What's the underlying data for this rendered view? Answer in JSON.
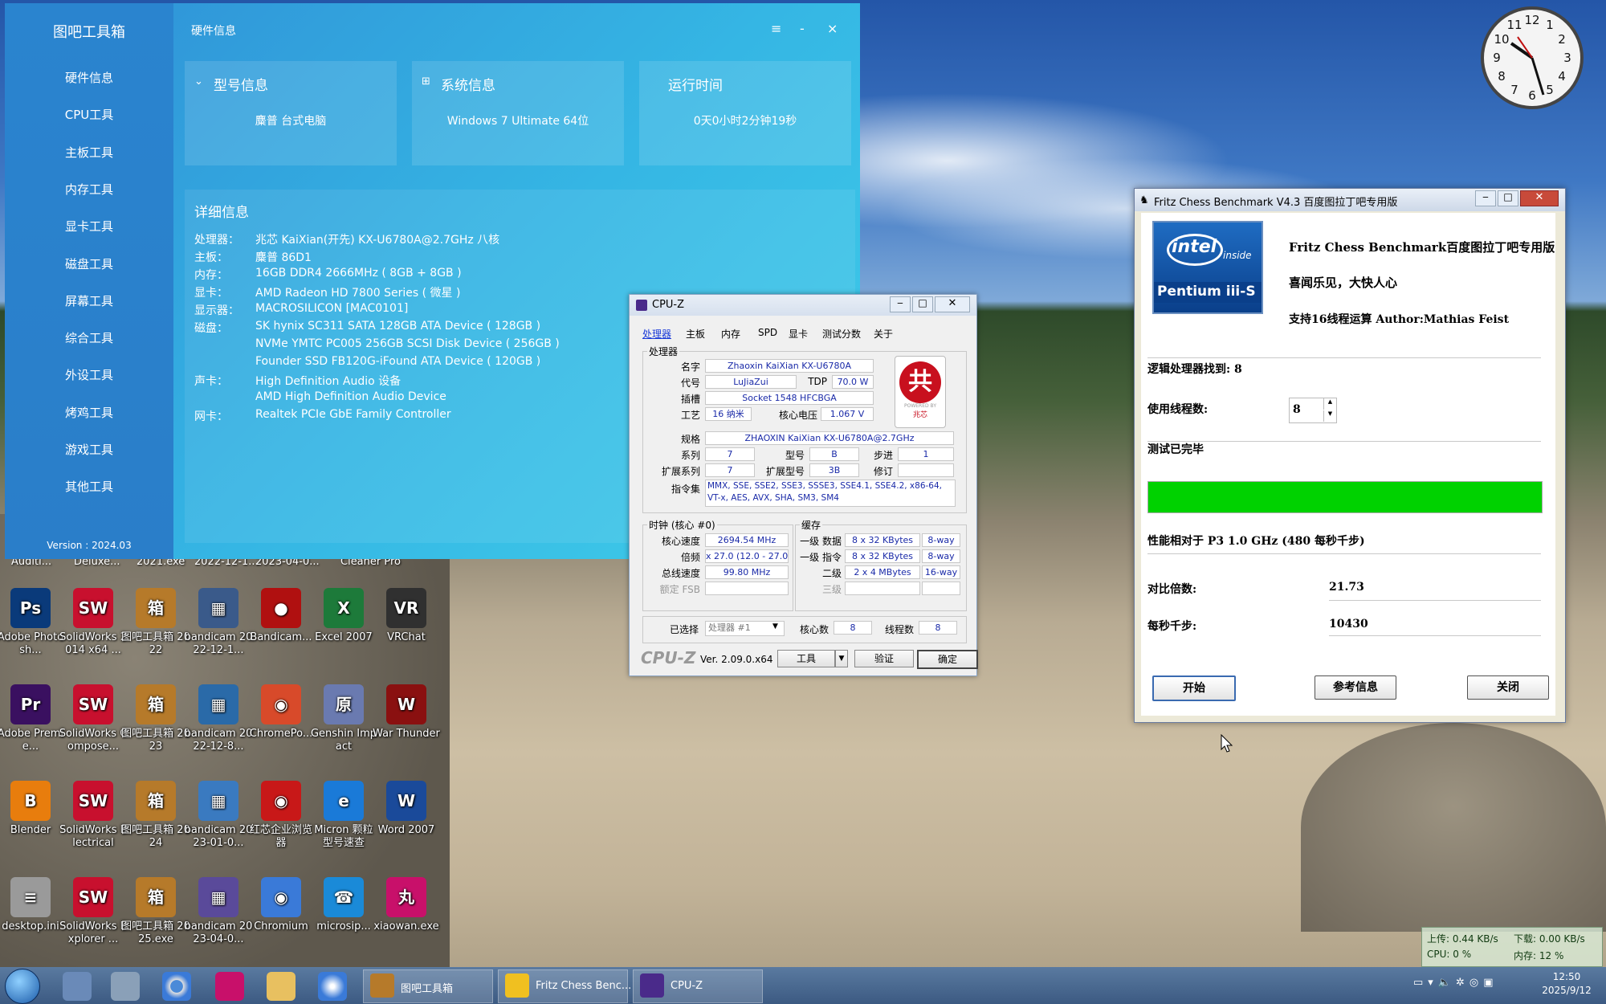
{
  "desktop_icons": [
    {
      "label": "Adobe Photosh...",
      "glyph": "Ps",
      "color": "#0a3a7a"
    },
    {
      "label": "SolidWorks 2014 x64 ...",
      "glyph": "SW",
      "color": "#c8102e"
    },
    {
      "label": "图吧工具箱 2022",
      "glyph": "箱",
      "color": "#b67a2a"
    },
    {
      "label": "bandicam 2022-12-1...",
      "glyph": "▦",
      "color": "#3a5a8a"
    },
    {
      "label": "Bandicam...",
      "glyph": "●",
      "color": "#b01010"
    },
    {
      "label": "Excel 2007",
      "glyph": "X",
      "color": "#1d7a3a"
    },
    {
      "label": "VRChat",
      "glyph": "VR",
      "color": "#303030"
    },
    {
      "label": "Adobe Premie...",
      "glyph": "Pr",
      "color": "#3a1060"
    },
    {
      "label": "SolidWorks Compose...",
      "glyph": "SW",
      "color": "#c8102e"
    },
    {
      "label": "图吧工具箱 2023",
      "glyph": "箱",
      "color": "#b67a2a"
    },
    {
      "label": "bandicam 2022-12-8...",
      "glyph": "▦",
      "color": "#2a6aa8"
    },
    {
      "label": "ChromePo...",
      "glyph": "◉",
      "color": "#d84a2a"
    },
    {
      "label": "Genshin Impact",
      "glyph": "原",
      "color": "#6a7ab0"
    },
    {
      "label": "War Thunder",
      "glyph": "W",
      "color": "#8a1010"
    },
    {
      "label": "Blender",
      "glyph": "B",
      "color": "#e87d0d"
    },
    {
      "label": "SolidWorks Electrical",
      "glyph": "SW",
      "color": "#c8102e"
    },
    {
      "label": "图吧工具箱 2024",
      "glyph": "箱",
      "color": "#b67a2a"
    },
    {
      "label": "bandicam 2023-01-0...",
      "glyph": "▦",
      "color": "#3a7ac0"
    },
    {
      "label": "红芯企业浏览器",
      "glyph": "◉",
      "color": "#c81818"
    },
    {
      "label": "Micron 颗粒型号速查",
      "glyph": "e",
      "color": "#1a7ad8"
    },
    {
      "label": "Word 2007",
      "glyph": "W",
      "color": "#1a4a9a"
    },
    {
      "label": "desktop.ini",
      "glyph": "≡",
      "color": "#9a9a9a"
    },
    {
      "label": "SolidWorks Explorer ...",
      "glyph": "SW",
      "color": "#c8102e"
    },
    {
      "label": "图吧工具箱 2025.exe",
      "glyph": "箱",
      "color": "#b67a2a"
    },
    {
      "label": "bandicam 2023-04-0...",
      "glyph": "▦",
      "color": "#5a4a9a"
    },
    {
      "label": "Chromium",
      "glyph": "◉",
      "color": "#3a7ad8"
    },
    {
      "label": "microsip...",
      "glyph": "☎",
      "color": "#1a8ad8"
    },
    {
      "label": "xiaowan.exe",
      "glyph": "丸",
      "color": "#c8106a"
    }
  ],
  "partial_icon_labels": [
    "Auditi...",
    "Deluxe...",
    "2021.exe",
    "2022-12-1...",
    "2023-04-0...",
    "Cleaner Pro"
  ],
  "tool": {
    "app_name": "图吧工具箱",
    "window_title": "硬件信息",
    "nav": [
      "硬件信息",
      "CPU工具",
      "主板工具",
      "内存工具",
      "显卡工具",
      "磁盘工具",
      "屏幕工具",
      "综合工具",
      "外设工具",
      "烤鸡工具",
      "游戏工具",
      "其他工具"
    ],
    "version": "Version : 2024.03",
    "btn_menu": "≡",
    "btn_min": "-",
    "btn_close": "×",
    "cards": [
      {
        "title": "型号信息",
        "value": "麋普 台式电脑"
      },
      {
        "title": "系统信息",
        "value": "Windows 7 Ultimate 64位"
      },
      {
        "title": "运行时间",
        "value": "0天0小时2分钟19秒"
      }
    ],
    "detail_title": "详细信息",
    "detail_rows": [
      {
        "k": "处理器：",
        "v": "兆芯 KaiXian(开先) KX-U6780A@2.7GHz 八核"
      },
      {
        "k": "主板：",
        "v": "麋普 86D1"
      },
      {
        "k": "内存：",
        "v": "16GB DDR4 2666MHz ( 8GB + 8GB )"
      },
      {
        "k": "显卡：",
        "v": "AMD Radeon HD 7800 Series ( 微星 )"
      },
      {
        "k": "显示器：",
        "v": "MACROSILICON [MAC0101]"
      },
      {
        "k": "磁盘：",
        "v": "SK hynix SC311 SATA 128GB ATA Device ( 128GB )"
      },
      {
        "k": "",
        "v": "NVMe YMTC PC005 256GB SCSI Disk Device ( 256GB )"
      },
      {
        "k": "",
        "v": "Founder SSD FB120G-iFound ATA Device ( 120GB )"
      },
      {
        "k": "声卡：",
        "v": "High Definition Audio 设备"
      },
      {
        "k": "",
        "v": "AMD High Definition Audio Device"
      },
      {
        "k": "网卡：",
        "v": "Realtek PCIe GbE Family Controller"
      }
    ]
  },
  "cpuz": {
    "title": "CPU-Z",
    "tabs": [
      "处理器",
      "主板",
      "内存",
      "SPD",
      "显卡",
      "测试分数",
      "关于"
    ],
    "group_processor": "处理器",
    "name_label": "名字",
    "name": "Zhaoxin KaiXian KX-U6780A",
    "code_label": "代号",
    "code": "LuJiaZui",
    "tdp_label": "TDP",
    "tdp": "70.0 W",
    "socket_label": "插槽",
    "socket": "Socket 1548 HFCBGA",
    "process_label": "工艺",
    "process": "16 纳米",
    "vcore_label": "核心电压",
    "vcore": "1.067 V",
    "spec_label": "规格",
    "spec": "ZHAOXIN KaiXian KX-U6780A@2.7GHz",
    "family_label": "系列",
    "family": "7",
    "model_label": "型号",
    "model": "B",
    "stepping_label": "步进",
    "stepping": "1",
    "extfamily_label": "扩展系列",
    "extfamily": "7",
    "extmodel_label": "扩展型号",
    "extmodel": "3B",
    "revision_label": "修订",
    "revision": "",
    "instr_label": "指令集",
    "instr": "MMX, SSE, SSE2, SSE3, SSSE3, SSE4.1, SSE4.2, x86-64, VT-x, AES, AVX, SHA, SM3, SM4",
    "group_clock": "时钟 (核心 #0)",
    "core_speed_label": "核心速度",
    "core_speed": "2694.54 MHz",
    "multiplier_label": "倍频",
    "multiplier": "x 27.0 (12.0 - 27.0)",
    "bus_label": "总线速度",
    "bus": "99.80 MHz",
    "fsb_label": "额定 FSB",
    "group_cache": "缓存",
    "l1d_label": "一级 数据",
    "l1d": "8 x 32 KBytes",
    "l1d_way": "8-way",
    "l1i_label": "一级 指令",
    "l1i": "8 x 32 KBytes",
    "l1i_way": "8-way",
    "l2_label": "二级",
    "l2": "2 x 4 MBytes",
    "l2_way": "16-way",
    "l3_label": "三级",
    "selected_label": "已选择",
    "selected": "处理器 #1",
    "cores_label": "核心数",
    "cores": "8",
    "threads_label": "线程数",
    "threads": "8",
    "brand": "CPU-Z",
    "version": "Ver. 2.09.0.x64",
    "btn_tools": "工具",
    "btn_validate": "验证",
    "btn_ok": "确定",
    "logo_powered": "POWERED BY",
    "logo_brand": "兆芯"
  },
  "fritz": {
    "title": "Fritz Chess Benchmark V4.3   百度图拉丁吧专用版",
    "logo_intel": "intel",
    "logo_inside": "inside",
    "logo_product": "Pentium iii-S",
    "header1": "Fritz Chess Benchmark百度图拉丁吧专用版",
    "header2": "喜闻乐见，大快人心",
    "header3": "支持16线程运算   Author:Mathias Feist",
    "logical_found": "逻辑处理器找到: 8",
    "threads_label": "使用线程数:",
    "threads_value": "8",
    "status": "测试已完毕",
    "progress_fraction": 1.0,
    "progress_color": "#00d200",
    "perf_label": "性能相对于 P3 1.0 GHz (480 每秒千步)",
    "ratio_label": "对比倍数:",
    "ratio_value": "21.73",
    "kns_label": "每秒千步:",
    "kns_value": "10430",
    "btn_start": "开始",
    "btn_info": "参考信息",
    "btn_close": "关闭"
  },
  "taskbar": {
    "tasks": [
      {
        "label": "图吧工具箱",
        "color": "#b67a2a"
      },
      {
        "label": "Fritz Chess Benc...",
        "color": "#f0c020"
      },
      {
        "label": "CPU-Z",
        "color": "#4a2a8a"
      }
    ],
    "clock_time": "12:50",
    "clock_date": "2025/9/12"
  },
  "netmon": {
    "upload": "上传: 0.44 KB/s",
    "download": "下载: 0.00 KB/s",
    "cpu": "CPU: 0 %",
    "memory": "内存: 12 %"
  },
  "colors": {
    "tool_accent": "#2f8fd6",
    "fritz_progress": "#00d200",
    "cpuz_value": "#1a2aa8"
  }
}
